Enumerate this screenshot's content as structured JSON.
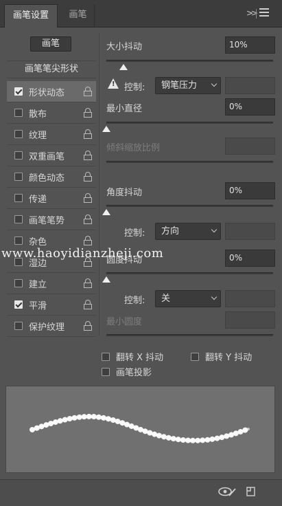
{
  "tabs": {
    "active": "画笔设置",
    "inactive": "画笔"
  },
  "tabbar_icons": {
    "expand": "expand-icon",
    "menu": "panel-menu-icon"
  },
  "brush_button": "画笔",
  "tip_header": "画笔笔尖形状",
  "left_items": [
    {
      "label": "形状动态",
      "checked": true,
      "selected": true
    },
    {
      "label": "散布",
      "checked": false
    },
    {
      "label": "纹理",
      "checked": false
    },
    {
      "label": "双重画笔",
      "checked": false
    },
    {
      "label": "颜色动态",
      "checked": false
    },
    {
      "label": "传递",
      "checked": false
    },
    {
      "label": "画笔笔势",
      "checked": false
    },
    {
      "label": "杂色",
      "checked": false
    },
    {
      "label": "湿边",
      "checked": false
    },
    {
      "label": "建立",
      "checked": false
    },
    {
      "label": "平滑",
      "checked": true
    },
    {
      "label": "保护纹理",
      "checked": false
    }
  ],
  "size_jitter": {
    "label": "大小抖动",
    "value": "10%",
    "slider_fraction": 0.1
  },
  "size_control": {
    "label": "控制:",
    "value": "钢笔压力"
  },
  "min_diameter": {
    "label": "最小直径",
    "value": "0%",
    "slider_fraction": 0.0
  },
  "tilt_scale": {
    "label": "倾斜缩放比例"
  },
  "angle_jitter": {
    "label": "角度抖动",
    "value": "0%",
    "slider_fraction": 0.0
  },
  "angle_control": {
    "label": "控制:",
    "value": "方向"
  },
  "roundness_jitter": {
    "label": "圆度抖动",
    "value": "0%",
    "slider_fraction": 0.0
  },
  "roundness_control": {
    "label": "控制:",
    "value": "关"
  },
  "min_roundness": {
    "label": "最小圆度"
  },
  "flip_x": {
    "label": "翻转 X 抖动",
    "checked": false
  },
  "flip_y": {
    "label": "翻转 Y 抖动",
    "checked": false
  },
  "brush_projection": {
    "label": "画笔投影",
    "checked": false
  },
  "watermark": "www.haoyidianzheji.com",
  "bottom_icons": {
    "eye": "eye-toggle-icon",
    "new": "new-preset-icon"
  }
}
